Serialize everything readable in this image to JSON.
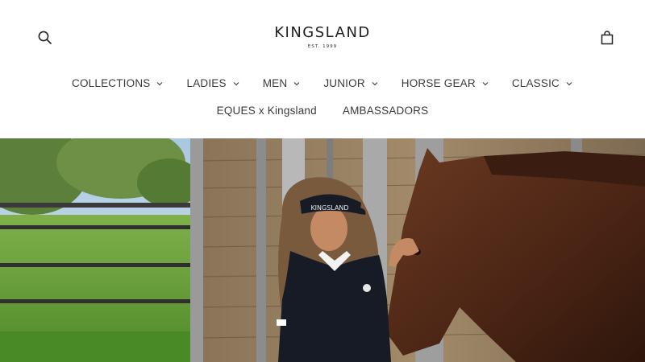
{
  "brand": {
    "name": "KINGSLAND",
    "tagline": "EST. 1999"
  },
  "icons": {
    "search": "search-icon",
    "cart": "shopping-bag-icon",
    "chevron": "chevron-down-icon"
  },
  "nav": {
    "primary": [
      {
        "label": "COLLECTIONS",
        "has_dropdown": true
      },
      {
        "label": "LADIES",
        "has_dropdown": true
      },
      {
        "label": "MEN",
        "has_dropdown": true
      },
      {
        "label": "JUNIOR",
        "has_dropdown": true
      },
      {
        "label": "HORSE GEAR",
        "has_dropdown": true
      },
      {
        "label": "CLASSIC",
        "has_dropdown": true
      }
    ],
    "secondary": [
      {
        "label": "EQUES x Kingsland"
      },
      {
        "label": "AMBASSADORS"
      }
    ]
  },
  "hero": {
    "visor_text": "KINGSLAND"
  },
  "colors": {
    "background": "#ffffff",
    "text": "#3a3a3a",
    "logo": "#1f1f1f"
  }
}
